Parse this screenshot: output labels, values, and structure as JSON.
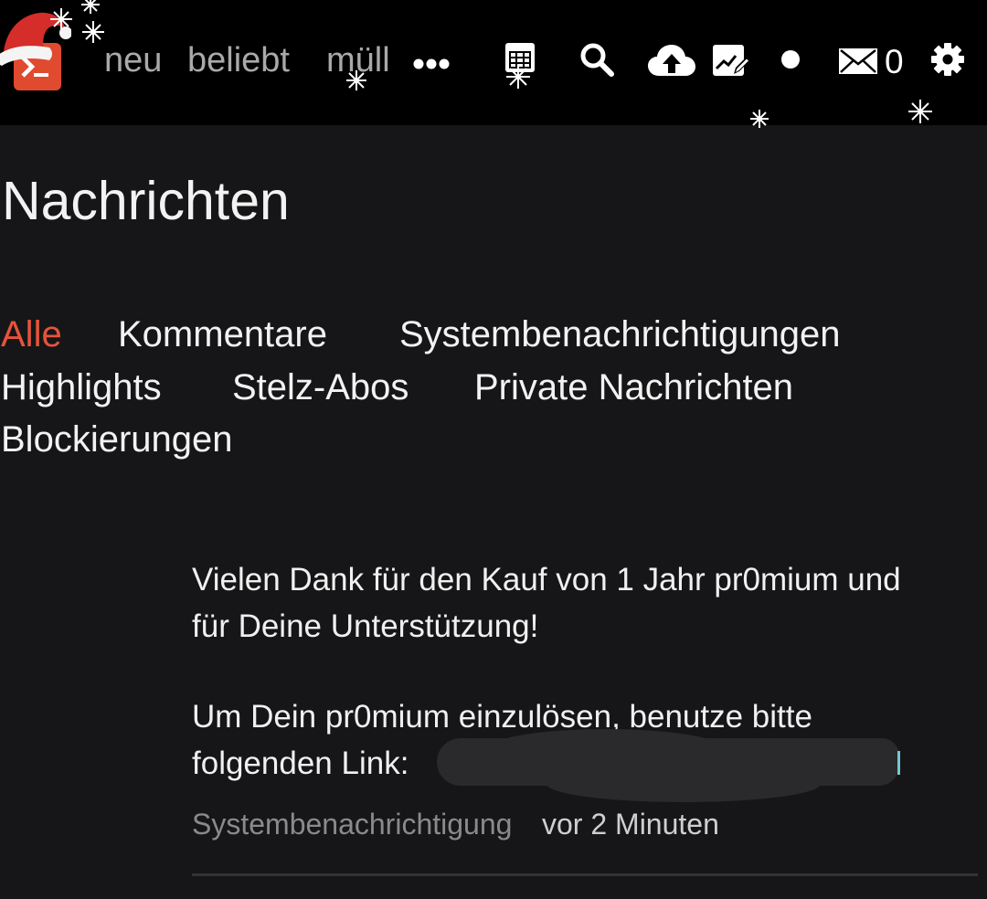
{
  "header": {
    "nav": [
      "neu",
      "beliebt",
      "müll"
    ],
    "more_label": "•••",
    "mail_count": "0",
    "icons": [
      "logo-icon",
      "santa-hat-icon",
      "more-icon",
      "calendar-icon",
      "search-icon",
      "upload-icon",
      "edit-icon",
      "status-dot-icon",
      "mail-icon",
      "gear-icon",
      "snowflake-icon"
    ]
  },
  "page": {
    "title": "Nachrichten"
  },
  "tabs": [
    {
      "label": "Alle",
      "active": true
    },
    {
      "label": "Kommentare",
      "active": false
    },
    {
      "label": "Systembenachrichtigungen",
      "active": false
    },
    {
      "label": "Highlights",
      "active": false
    },
    {
      "label": "Stelz-Abos",
      "active": false
    },
    {
      "label": "Private Nachrichten",
      "active": false
    },
    {
      "label": "Blockierungen",
      "active": false
    }
  ],
  "message": {
    "line1": "Vielen Dank für den Kauf von 1 Jahr pr0mium und",
    "line2": "für Deine Unterstützung!",
    "line3": "Um Dein pr0mium einzulösen, benutze bitte",
    "line4": "folgenden Link:",
    "type": "Systembenachrichtigung",
    "time": "vor 2 Minuten"
  },
  "colors": {
    "accent": "#e5543a",
    "logo_bg": "#e04a2f",
    "header_bg": "#000000",
    "page_bg": "#161618"
  }
}
